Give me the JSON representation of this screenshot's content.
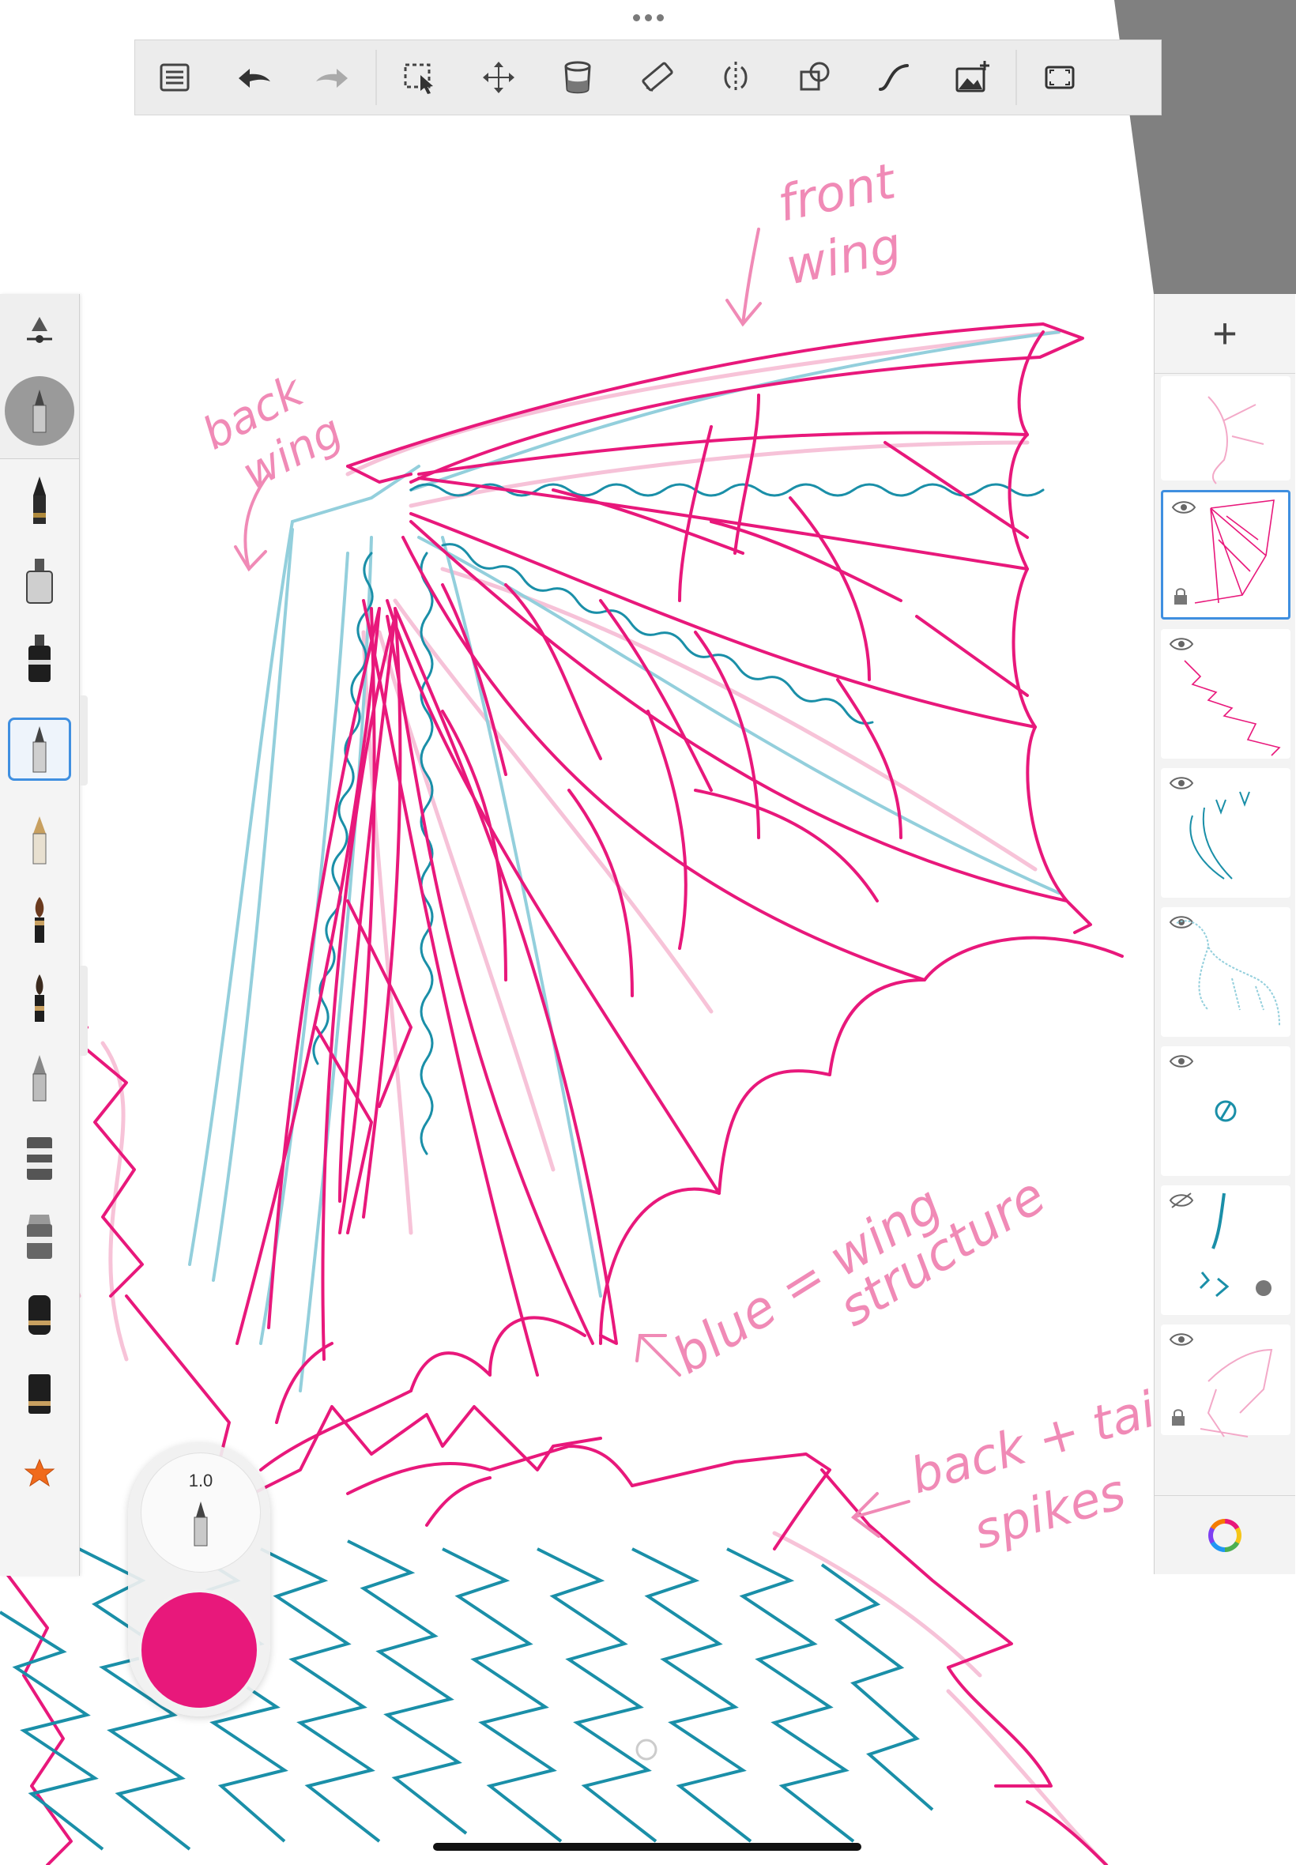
{
  "toolbar": {
    "items": [
      {
        "name": "layer-list-button",
        "icon": "list-icon"
      },
      {
        "name": "undo-button",
        "icon": "undo-icon"
      },
      {
        "name": "redo-button",
        "icon": "redo-icon"
      },
      {
        "name": "selection-button",
        "icon": "selection-icon"
      },
      {
        "name": "transform-button",
        "icon": "move-icon"
      },
      {
        "name": "fill-button",
        "icon": "bucket-icon"
      },
      {
        "name": "ruler-button",
        "icon": "ruler-icon"
      },
      {
        "name": "symmetry-button",
        "icon": "symmetry-icon"
      },
      {
        "name": "shapes-button",
        "icon": "shapes-icon"
      },
      {
        "name": "stroke-button",
        "icon": "curve-icon"
      },
      {
        "name": "add-image-button",
        "icon": "image-add-icon"
      },
      {
        "name": "fullscreen-button",
        "icon": "fullscreen-icon"
      }
    ]
  },
  "brush_puck": {
    "size_value": "1.0",
    "active_color": "#e8187b"
  },
  "brush_panel": {
    "brushes": [
      "brush-settings-icon",
      "pencil-brush-icon",
      "marker-brush-icon",
      "ink-pen-brush-icon",
      "ballpoint-brush-icon",
      "fountain-pen-brush-icon",
      "paintbrush-brush-icon",
      "flat-brush-icon",
      "airbrush-brush-icon",
      "chisel-marker-brush-icon",
      "wide-marker-brush-icon",
      "eraser-hard-brush-icon",
      "eraser-soft-brush-icon",
      "favorite-star-icon"
    ],
    "selected_brush": "ballpoint-brush-icon"
  },
  "layers": {
    "add_label": "+",
    "items": [
      {
        "name": "layer-1",
        "visible": true,
        "locked": false
      },
      {
        "name": "layer-2",
        "visible": true,
        "locked": true,
        "selected": true
      },
      {
        "name": "layer-3",
        "visible": true,
        "locked": false
      },
      {
        "name": "layer-4",
        "visible": true,
        "locked": false
      },
      {
        "name": "layer-5",
        "visible": true,
        "locked": false
      },
      {
        "name": "layer-6",
        "visible": true,
        "locked": false
      },
      {
        "name": "layer-7",
        "visible": false,
        "locked": false
      },
      {
        "name": "layer-8",
        "visible": true,
        "locked": true
      }
    ]
  },
  "canvas_annotations": {
    "front_wing_1": "front",
    "front_wing_2": "wing",
    "back_wing_1": "back",
    "back_wing_2": "wing",
    "blue_1": "blue = wing",
    "blue_2": "structure",
    "spikes_1": "back + tail",
    "spikes_2": "spikes"
  },
  "colors": {
    "pink": "#e8187b",
    "teal": "#1a8fa8",
    "light_pink": "#f3a9c8",
    "light_teal": "#93cfdc",
    "toolbar_bg": "#ececec",
    "accent": "#3f8fe0"
  }
}
